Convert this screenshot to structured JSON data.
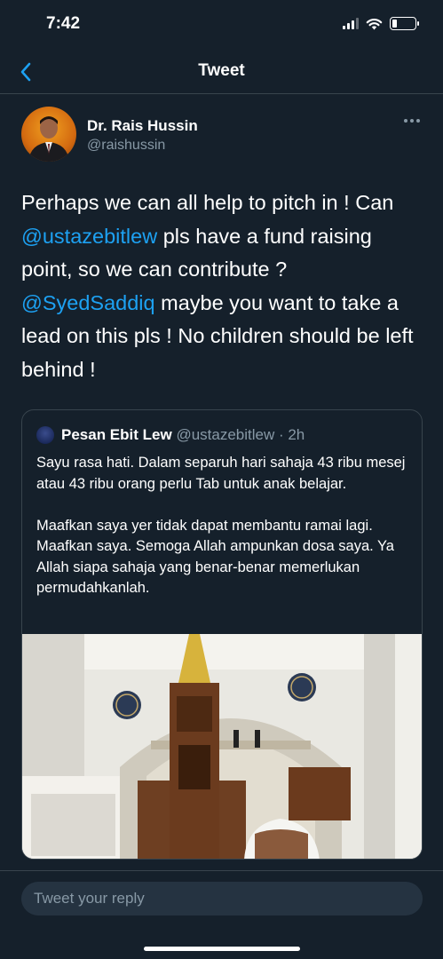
{
  "status_bar": {
    "time": "7:42"
  },
  "nav": {
    "title": "Tweet"
  },
  "tweet": {
    "author_name": "Dr. Rais Hussin",
    "author_handle": "@raishussin",
    "text_segments": [
      "Perhaps we can all help to pitch in ! Can ",
      "@ustazebitlew",
      " pls have a fund raising point, so we can contribute ? ",
      "@SyedSaddiq",
      " maybe you want to take a lead on this pls ! No children should be left behind !"
    ]
  },
  "quote": {
    "author_name": "Pesan Ebit Lew",
    "author_handle": "@ustazebitlew · 2h",
    "text": "Sayu rasa hati. Dalam separuh hari sahaja 43 ribu mesej atau 43 ribu orang perlu Tab untuk anak belajar.\n\nMaafkan saya yer tidak dapat membantu ramai lagi. Maafkan saya. Semoga Allah ampunkan dosa saya. Ya Allah siapa sahaja yang benar-benar memerlukan permudahkanlah."
  },
  "reply": {
    "placeholder": "Tweet your reply"
  },
  "colors": {
    "background": "#15202b",
    "accent": "#1da1f2",
    "secondary_text": "#8899a6",
    "divider": "#38444d"
  },
  "icons": {
    "back": "chevron-left-icon",
    "more": "more-horizontal-icon",
    "signal": "cellular-signal-icon",
    "wifi": "wifi-icon",
    "battery": "battery-icon"
  }
}
